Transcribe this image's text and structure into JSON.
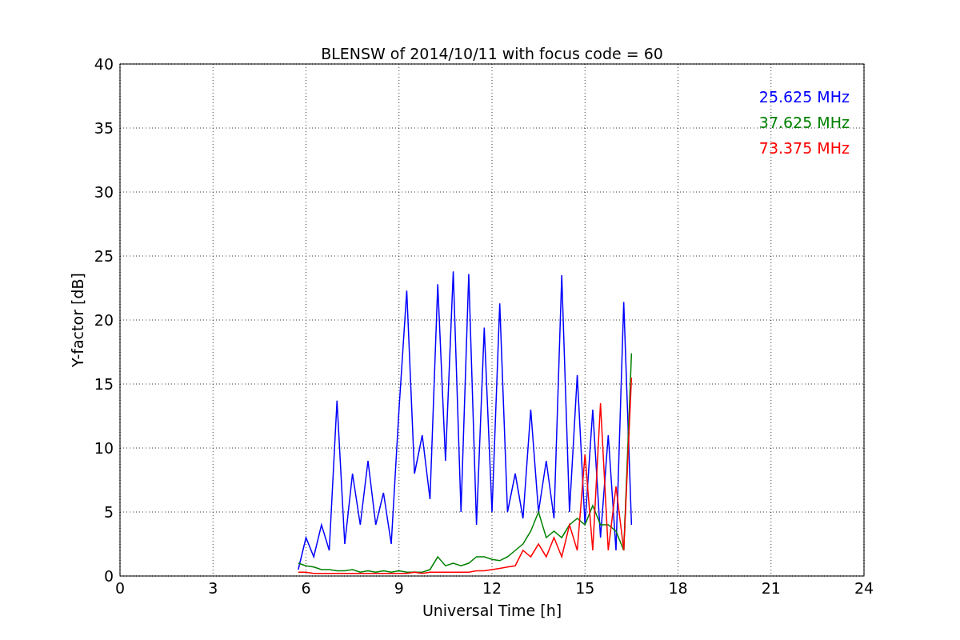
{
  "figure": {
    "chart_data": {
      "type": "line",
      "grid": true,
      "title": "BLENSW of 2014/10/11 with focus code = 60",
      "xlabel": "Universal Time [h]",
      "ylabel": "Y-factor [dB]",
      "xlim": [
        0,
        24
      ],
      "ylim": [
        0,
        40
      ],
      "xticks": [
        0,
        3,
        6,
        9,
        12,
        15,
        18,
        21,
        24
      ],
      "yticks": [
        0,
        5,
        10,
        15,
        20,
        25,
        30,
        35,
        40
      ],
      "x": [
        5.75,
        6.0,
        6.25,
        6.5,
        6.75,
        7.0,
        7.25,
        7.5,
        7.75,
        8.0,
        8.25,
        8.5,
        8.75,
        9.0,
        9.25,
        9.5,
        9.75,
        10.0,
        10.25,
        10.5,
        10.75,
        11.0,
        11.25,
        11.5,
        11.75,
        12.0,
        12.25,
        12.5,
        12.75,
        13.0,
        13.25,
        13.5,
        13.75,
        14.0,
        14.25,
        14.5,
        14.75,
        15.0,
        15.25,
        15.5,
        15.75,
        16.0,
        16.25,
        16.5
      ],
      "series": [
        {
          "name": "25.625 MHz",
          "color": "#0000ff",
          "values": [
            0.5,
            3,
            1.5,
            4,
            2,
            13.7,
            2.5,
            8,
            4,
            9,
            4,
            6.5,
            2.5,
            13,
            22.3,
            8,
            11,
            6,
            22.8,
            9,
            23.8,
            5,
            23.6,
            4,
            19.4,
            5,
            21.3,
            5,
            8,
            4.5,
            13,
            5,
            9,
            4.5,
            23.5,
            5,
            15.7,
            4,
            13,
            3,
            11,
            2,
            21.4,
            4
          ]
        },
        {
          "name": "37.625 MHz",
          "color": "#008000",
          "values": [
            1.0,
            0.8,
            0.7,
            0.5,
            0.5,
            0.4,
            0.4,
            0.5,
            0.3,
            0.4,
            0.3,
            0.4,
            0.3,
            0.4,
            0.3,
            0.3,
            0.3,
            0.5,
            1.5,
            0.8,
            1.0,
            0.8,
            1.0,
            1.5,
            1.5,
            1.3,
            1.2,
            1.5,
            2.0,
            2.5,
            3.5,
            5,
            3,
            3.5,
            3,
            4,
            4.5,
            4,
            5.5,
            4,
            4,
            3.5,
            2,
            17.4
          ]
        },
        {
          "name": "73.375 MHz",
          "color": "#ff0000",
          "values": [
            0.3,
            0.3,
            0.2,
            0.2,
            0.2,
            0.2,
            0.2,
            0.2,
            0.2,
            0.2,
            0.2,
            0.2,
            0.2,
            0.2,
            0.2,
            0.3,
            0.2,
            0.3,
            0.3,
            0.3,
            0.3,
            0.3,
            0.3,
            0.4,
            0.4,
            0.5,
            0.6,
            0.7,
            0.8,
            2,
            1.5,
            2.5,
            1.5,
            3,
            1.5,
            4,
            2,
            9.5,
            2,
            13.5,
            2,
            7,
            2,
            15.5
          ]
        }
      ]
    }
  }
}
